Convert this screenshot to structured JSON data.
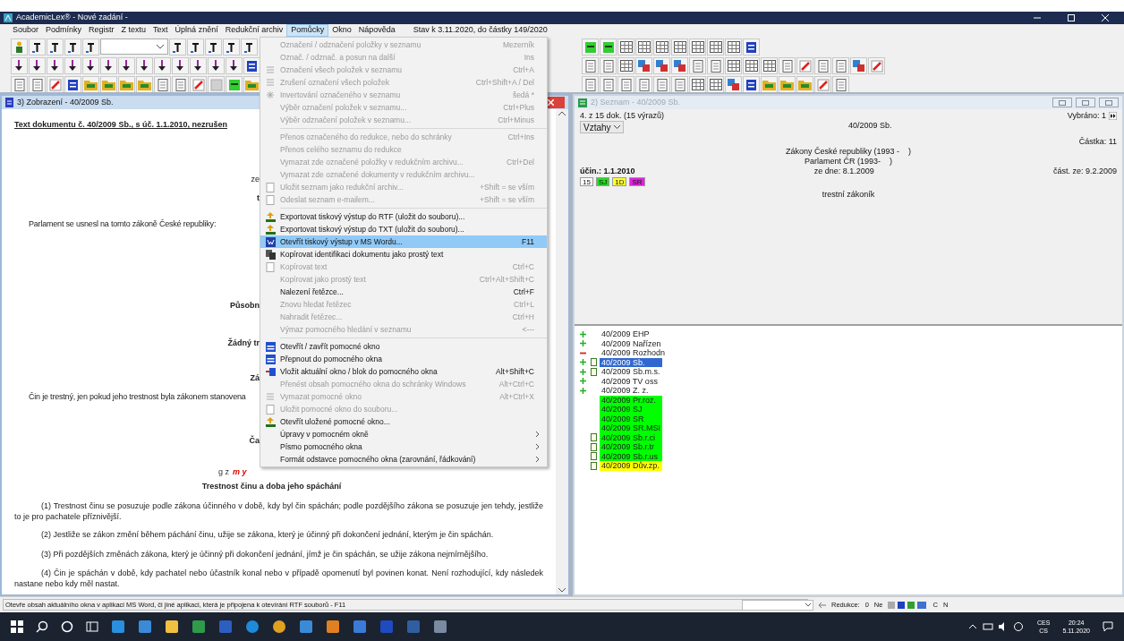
{
  "window": {
    "title": "AcademicLex® - Nové zadání -"
  },
  "menubar": {
    "items": [
      {
        "label": "Soubor",
        "selected": false
      },
      {
        "label": "Podmínky",
        "selected": false
      },
      {
        "label": "Registr",
        "selected": false
      },
      {
        "label": "Z textu",
        "selected": false
      },
      {
        "label": "Text",
        "selected": false
      },
      {
        "label": "Úplná znění",
        "selected": false
      },
      {
        "label": "Redukční archiv",
        "selected": false
      },
      {
        "label": "Pomůcky",
        "selected": true
      },
      {
        "label": "Okno",
        "selected": false
      },
      {
        "label": "Nápověda",
        "selected": false
      }
    ],
    "status": "Stav k 3.11.2020, do částky 149/2020"
  },
  "toolbars": [
    {
      "left": [
        {
          "kind": "person"
        },
        {
          "kind": "letter"
        },
        {
          "kind": "letter"
        },
        {
          "kind": "letter"
        },
        {
          "kind": "letter"
        },
        {
          "kind": "combo"
        },
        {
          "kind": "letter"
        },
        {
          "kind": "letter"
        },
        {
          "kind": "letter"
        },
        {
          "kind": "letter"
        },
        {
          "kind": "letter"
        }
      ],
      "right": [
        {
          "kind": "green"
        },
        {
          "kind": "green"
        },
        {
          "kind": "grid"
        },
        {
          "kind": "grid"
        },
        {
          "kind": "grid"
        },
        {
          "kind": "grid"
        },
        {
          "kind": "grid"
        },
        {
          "kind": "grid"
        },
        {
          "kind": "grid"
        },
        {
          "kind": "blue"
        }
      ]
    },
    {
      "left": [
        {
          "kind": "arrow"
        },
        {
          "kind": "arrow"
        },
        {
          "kind": "arrow"
        },
        {
          "kind": "arrow"
        },
        {
          "kind": "arrow"
        },
        {
          "kind": "arrow"
        },
        {
          "kind": "arrow"
        },
        {
          "kind": "arrow"
        },
        {
          "kind": "arrow"
        },
        {
          "kind": "arrow"
        },
        {
          "kind": "arrow"
        },
        {
          "kind": "arrow"
        },
        {
          "kind": "arrow"
        },
        {
          "kind": "blue"
        }
      ],
      "right": [
        {
          "kind": "page"
        },
        {
          "kind": "page"
        },
        {
          "kind": "grid"
        },
        {
          "kind": "stack"
        },
        {
          "kind": "stack"
        },
        {
          "kind": "stack"
        },
        {
          "kind": "page"
        },
        {
          "kind": "page"
        },
        {
          "kind": "grid"
        },
        {
          "kind": "grid"
        },
        {
          "kind": "grid"
        },
        {
          "kind": "page"
        },
        {
          "kind": "red"
        },
        {
          "kind": "page"
        },
        {
          "kind": "page"
        },
        {
          "kind": "stack"
        },
        {
          "kind": "red"
        }
      ]
    },
    {
      "left": [
        {
          "kind": "page"
        },
        {
          "kind": "page"
        },
        {
          "kind": "red"
        },
        {
          "kind": "blue"
        },
        {
          "kind": "folder"
        },
        {
          "kind": "folder"
        },
        {
          "kind": "folder"
        },
        {
          "kind": "folder"
        },
        {
          "kind": "page"
        },
        {
          "kind": "page"
        },
        {
          "kind": "red"
        },
        {
          "kind": "gray"
        },
        {
          "kind": "green"
        },
        {
          "kind": "folder"
        }
      ],
      "right": [
        {
          "kind": "page"
        },
        {
          "kind": "page"
        },
        {
          "kind": "page"
        },
        {
          "kind": "page"
        },
        {
          "kind": "page"
        },
        {
          "kind": "page"
        },
        {
          "kind": "grid"
        },
        {
          "kind": "grid"
        },
        {
          "kind": "stack"
        },
        {
          "kind": "blue"
        },
        {
          "kind": "folder"
        },
        {
          "kind": "folder"
        },
        {
          "kind": "folder"
        },
        {
          "kind": "red"
        },
        {
          "kind": "page"
        }
      ]
    }
  ],
  "menu": {
    "groups": [
      [
        {
          "label": "Označení / odznačení položky v seznamu",
          "shortcut": "Mezerník",
          "disabled": true,
          "selected": false,
          "kind": "plain",
          "submenu": false
        },
        {
          "label": "Označ. / odznač. a posun na další",
          "shortcut": "Ins",
          "disabled": true,
          "selected": false,
          "kind": "plain",
          "submenu": false
        },
        {
          "label": "Označení všech položek v seznamu",
          "shortcut": "Ctrl+A",
          "disabled": true,
          "selected": false,
          "kind": "list",
          "submenu": false
        },
        {
          "label": "Zrušení označení všech položek",
          "shortcut": "Ctrl+Shift+A / Del",
          "disabled": true,
          "selected": false,
          "kind": "list",
          "submenu": false
        },
        {
          "label": "Invertování označeného v seznamu",
          "shortcut": "šedá *",
          "disabled": true,
          "selected": false,
          "kind": "star",
          "submenu": false
        },
        {
          "label": "Výběr označení položek v seznamu...",
          "shortcut": "Ctrl+Plus",
          "disabled": true,
          "selected": false,
          "kind": "plain",
          "submenu": false
        },
        {
          "label": "Výběr odznačení položek v seznamu...",
          "shortcut": "Ctrl+Minus",
          "disabled": true,
          "selected": false,
          "kind": "plain",
          "submenu": false
        }
      ],
      [
        {
          "label": "Přenos označeného do redukce, nebo do schránky",
          "shortcut": "Ctrl+Ins",
          "disabled": true,
          "selected": false,
          "kind": "plain",
          "submenu": false
        },
        {
          "label": "Přenos celého seznamu do redukce",
          "disabled": true,
          "selected": false,
          "kind": "plain",
          "submenu": false
        },
        {
          "label": "Vymazat zde označené položky v redukčním archivu...",
          "shortcut": "Ctrl+Del",
          "disabled": true,
          "selected": false,
          "kind": "plain",
          "submenu": false
        },
        {
          "label": "Vymazat zde označené dokumenty v redukčním archivu...",
          "disabled": true,
          "selected": false,
          "kind": "plain",
          "submenu": false
        },
        {
          "label": "Uložit seznam jako redukční archiv...",
          "shortcut": "+Shift = se vším",
          "disabled": true,
          "selected": false,
          "kind": "page",
          "submenu": false
        },
        {
          "label": "Odeslat seznam e-mailem...",
          "shortcut": "+Shift = se vším",
          "disabled": true,
          "selected": false,
          "kind": "page",
          "submenu": false
        }
      ],
      [
        {
          "label": "Exportovat tiskový výstup do RTF (uložit do souboru)...",
          "disabled": false,
          "selected": false,
          "kind": "export",
          "submenu": false
        },
        {
          "label": "Exportovat tiskový výstup do TXT (uložit do souboru)...",
          "disabled": false,
          "selected": false,
          "kind": "export",
          "submenu": false
        },
        {
          "label": "Otevřít tiskový výstup v MS Wordu...",
          "shortcut": "F11",
          "disabled": false,
          "selected": true,
          "kind": "word",
          "submenu": false
        },
        {
          "label": "Kopírovat identifikaci dokumentu jako prostý text",
          "disabled": false,
          "selected": false,
          "kind": "copy",
          "submenu": false
        },
        {
          "label": "Kopírovat text",
          "shortcut": "Ctrl+C",
          "disabled": true,
          "selected": false,
          "kind": "page",
          "submenu": false
        },
        {
          "label": "Kopírovat jako prostý text",
          "shortcut": "Ctrl+Alt+Shift+C",
          "disabled": true,
          "selected": false,
          "kind": "plain",
          "submenu": false
        },
        {
          "label": "Nalezení řetězce...",
          "shortcut": "Ctrl+F",
          "disabled": false,
          "selected": false,
          "kind": "plain",
          "submenu": false
        },
        {
          "label": "Znovu hledat řetězec",
          "shortcut": "Ctrl+L",
          "disabled": true,
          "selected": false,
          "kind": "plain",
          "submenu": false
        },
        {
          "label": "Nahradit řetězec...",
          "shortcut": "Ctrl+H",
          "disabled": true,
          "selected": false,
          "kind": "plain",
          "submenu": false
        },
        {
          "label": "Výmaz pomocného hledání v seznamu",
          "shortcut": "<---",
          "disabled": true,
          "selected": false,
          "kind": "plain",
          "submenu": false
        }
      ],
      [
        {
          "label": "Otevřít / zavřít pomocné okno",
          "disabled": false,
          "selected": false,
          "kind": "window",
          "submenu": false
        },
        {
          "label": "Přepnout do pomocného okna",
          "disabled": false,
          "selected": false,
          "kind": "window",
          "submenu": false
        },
        {
          "label": "Vložit aktuální okno / blok do pomocného okna",
          "shortcut": "Alt+Shift+C",
          "disabled": false,
          "selected": false,
          "kind": "insert",
          "submenu": false
        },
        {
          "label": "Přenést obsah pomocného okna do schránky Windows",
          "shortcut": "Alt+Ctrl+C",
          "disabled": true,
          "selected": false,
          "kind": "plain",
          "submenu": false
        },
        {
          "label": "Vymazat pomocné okno",
          "shortcut": "Alt+Ctrl+X",
          "disabled": true,
          "selected": false,
          "kind": "list",
          "submenu": false
        },
        {
          "label": "Uložit pomocné okno do souboru...",
          "disabled": true,
          "selected": false,
          "kind": "page",
          "submenu": false
        },
        {
          "label": "Otevřít uložené pomocné okno...",
          "disabled": false,
          "selected": false,
          "kind": "export",
          "submenu": false
        },
        {
          "label": "Úpravy v pomocném okně",
          "disabled": false,
          "selected": false,
          "kind": "plain",
          "submenu": true
        },
        {
          "label": "Písmo pomocného okna",
          "disabled": false,
          "selected": false,
          "kind": "plain",
          "submenu": true
        },
        {
          "label": "Formát odstavce pomocného okna (zarovnání, řádkování)",
          "disabled": false,
          "selected": false,
          "kind": "plain",
          "submenu": true
        }
      ]
    ]
  },
  "document_window": {
    "title": "3) Zobrazení - 40/2009 Sb.",
    "lines": [
      {
        "kind": "heading",
        "text": "Text dokumentu č. 40/2009 Sb., s úč. 1.1.2010, nezrušen"
      },
      {
        "kind": "cut",
        "text": "ze"
      },
      {
        "kind": "cut_bold",
        "text": "t"
      },
      {
        "kind": "indent",
        "text": "Parlament se usnesl na tomto zákoně České republiky:"
      },
      {
        "kind": "cut_bold",
        "text": "Působn"
      },
      {
        "kind": "cut_bold",
        "text": "Žádný tr"
      },
      {
        "kind": "cut_bold",
        "text": "Zá"
      },
      {
        "kind": "indent",
        "text": "Čin je trestný, jen pokud jeho trestnost byla zákonem stanovena"
      },
      {
        "kind": "cut_bold",
        "text": "Ča"
      },
      {
        "kind": "marked",
        "parts": [
          {
            "text": "g z",
            "highlight": false
          },
          {
            "text": "m y",
            "highlight": true
          }
        ]
      },
      {
        "kind": "center_bold",
        "text": "Trestnost činu a doba jeho spáchání"
      },
      {
        "kind": "para",
        "text": "(1) Trestnost činu se posuzuje podle zákona účinného v době, kdy byl čin spáchán; podle pozdějšího zákona se posuzuje jen tehdy, jestliže to je pro pachatele příznivější."
      },
      {
        "kind": "para",
        "text": "(2) Jestliže se zákon změní během páchání činu, užije se zákona, který je účinný při dokončení jednání, kterým je čin spáchán."
      },
      {
        "kind": "para",
        "text": "(3) Při pozdějších změnách zákona, který je účinný při dokončení jednání, jímž je čin spáchán, se užije zákona nejmírnějšího."
      },
      {
        "kind": "para",
        "text": "(4) Čin je spáchán v době, kdy pachatel nebo účastník konal nebo v případě opomenutí byl povinen konat. Není rozhodující, kdy následek nastane nebo kdy měl nastat."
      }
    ]
  },
  "list_window": {
    "title": "2) Seznam - 40/2009 Sb.",
    "count": "4. z 15 dok. (15 výrazů)",
    "selected_info": "Vybráno: 1",
    "relations": "Vztahy",
    "doc_number": "40/2009 Sb.",
    "castka": "Částka: 11",
    "source": "Zákony České republiky (1993 -    )",
    "author": "Parlament ČR (1993-    )",
    "date": "ze dne: 8.1.2009",
    "effective": "účin.: 1.1.2010",
    "castka_date": "část. ze: 9.2.2009",
    "badges": [
      {
        "text": "15",
        "color": "#ffffff"
      },
      {
        "text": "SJ",
        "color": "#22dd22"
      },
      {
        "text": "1D",
        "color": "#ffff33"
      },
      {
        "text": "SR",
        "color": "#dd22dd"
      }
    ],
    "name": "trestní zákoník",
    "items": [
      {
        "text": "40/2009 EHP",
        "kind": "plus",
        "doc": false,
        "selected": false
      },
      {
        "text": "40/2009 Nařízen",
        "kind": "plus",
        "doc": false,
        "selected": false
      },
      {
        "text": "40/2009 Rozhodn",
        "kind": "minus",
        "doc": false,
        "selected": false
      },
      {
        "text": "40/2009 Sb.",
        "kind": "plus",
        "doc": true,
        "selected": true
      },
      {
        "text": "40/2009 Sb.m.s.",
        "kind": "plus",
        "doc": true,
        "selected": false
      },
      {
        "text": "40/2009 TV oss",
        "kind": "plus",
        "doc": false,
        "selected": false
      },
      {
        "text": "40/2009 Z. z.",
        "kind": "plus",
        "doc": false,
        "selected": false
      },
      {
        "text": "40/2009 Pr.roz.",
        "kind": "none",
        "doc": false,
        "selected": false,
        "color": "#00ff00"
      },
      {
        "text": "40/2009 SJ",
        "kind": "none",
        "doc": false,
        "selected": false,
        "color": "#00ff00"
      },
      {
        "text": "40/2009 SR",
        "kind": "none",
        "doc": false,
        "selected": false,
        "color": "#00ff00"
      },
      {
        "text": "40/2009 SR.MSI",
        "kind": "none",
        "doc": false,
        "selected": false,
        "color": "#00ff00"
      },
      {
        "text": "40/2009 Sb.r.ci",
        "kind": "none",
        "doc": true,
        "selected": false,
        "color": "#00ff00"
      },
      {
        "text": "40/2009 Sb.r.tr",
        "kind": "none",
        "doc": true,
        "selected": false,
        "color": "#00ff00"
      },
      {
        "text": "40/2009 Sb.r.us",
        "kind": "none",
        "doc": true,
        "selected": false,
        "color": "#00ff00"
      },
      {
        "text": "40/2009 Dův.zp.",
        "kind": "none",
        "doc": true,
        "selected": false,
        "color": "#ffff00"
      }
    ]
  },
  "status_bar": {
    "hint": "Otevře obsah aktuálního okna v aplikaci MS Word, či jiné aplikaci, která je připojena k otevírání RTF souborů - F11",
    "reduction_label": "Redukce:",
    "reduction_value": "0",
    "flag": "Ne",
    "letters": [
      "C",
      "N"
    ]
  },
  "taskbar": {
    "apps": [
      {
        "kind": "start"
      },
      {
        "kind": "search"
      },
      {
        "kind": "cortana"
      },
      {
        "kind": "tasks"
      },
      {
        "kind": "app"
      },
      {
        "kind": "app"
      },
      {
        "kind": "app"
      },
      {
        "kind": "app"
      },
      {
        "kind": "app"
      },
      {
        "kind": "round"
      },
      {
        "kind": "round"
      },
      {
        "kind": "app"
      },
      {
        "kind": "app"
      },
      {
        "kind": "app"
      },
      {
        "kind": "app"
      },
      {
        "kind": "app"
      },
      {
        "kind": "app"
      }
    ],
    "language": "CES",
    "layout": "CS",
    "time": "20:24",
    "date": "5.11.2020"
  }
}
